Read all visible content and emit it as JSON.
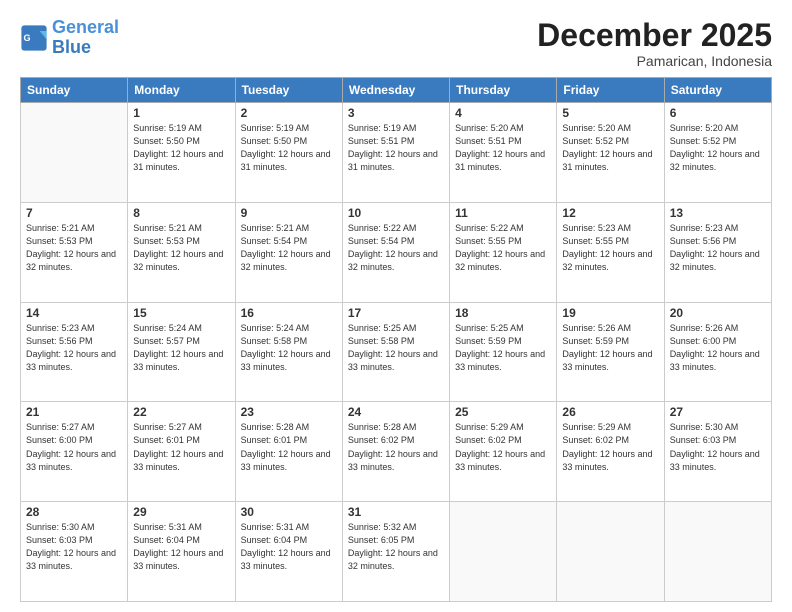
{
  "logo": {
    "line1": "General",
    "line2": "Blue"
  },
  "title": "December 2025",
  "location": "Pamarican, Indonesia",
  "weekdays": [
    "Sunday",
    "Monday",
    "Tuesday",
    "Wednesday",
    "Thursday",
    "Friday",
    "Saturday"
  ],
  "weeks": [
    [
      {
        "day": "",
        "sunrise": "",
        "sunset": "",
        "daylight": ""
      },
      {
        "day": "1",
        "sunrise": "Sunrise: 5:19 AM",
        "sunset": "Sunset: 5:50 PM",
        "daylight": "Daylight: 12 hours and 31 minutes."
      },
      {
        "day": "2",
        "sunrise": "Sunrise: 5:19 AM",
        "sunset": "Sunset: 5:50 PM",
        "daylight": "Daylight: 12 hours and 31 minutes."
      },
      {
        "day": "3",
        "sunrise": "Sunrise: 5:19 AM",
        "sunset": "Sunset: 5:51 PM",
        "daylight": "Daylight: 12 hours and 31 minutes."
      },
      {
        "day": "4",
        "sunrise": "Sunrise: 5:20 AM",
        "sunset": "Sunset: 5:51 PM",
        "daylight": "Daylight: 12 hours and 31 minutes."
      },
      {
        "day": "5",
        "sunrise": "Sunrise: 5:20 AM",
        "sunset": "Sunset: 5:52 PM",
        "daylight": "Daylight: 12 hours and 31 minutes."
      },
      {
        "day": "6",
        "sunrise": "Sunrise: 5:20 AM",
        "sunset": "Sunset: 5:52 PM",
        "daylight": "Daylight: 12 hours and 32 minutes."
      }
    ],
    [
      {
        "day": "7",
        "sunrise": "Sunrise: 5:21 AM",
        "sunset": "Sunset: 5:53 PM",
        "daylight": "Daylight: 12 hours and 32 minutes."
      },
      {
        "day": "8",
        "sunrise": "Sunrise: 5:21 AM",
        "sunset": "Sunset: 5:53 PM",
        "daylight": "Daylight: 12 hours and 32 minutes."
      },
      {
        "day": "9",
        "sunrise": "Sunrise: 5:21 AM",
        "sunset": "Sunset: 5:54 PM",
        "daylight": "Daylight: 12 hours and 32 minutes."
      },
      {
        "day": "10",
        "sunrise": "Sunrise: 5:22 AM",
        "sunset": "Sunset: 5:54 PM",
        "daylight": "Daylight: 12 hours and 32 minutes."
      },
      {
        "day": "11",
        "sunrise": "Sunrise: 5:22 AM",
        "sunset": "Sunset: 5:55 PM",
        "daylight": "Daylight: 12 hours and 32 minutes."
      },
      {
        "day": "12",
        "sunrise": "Sunrise: 5:23 AM",
        "sunset": "Sunset: 5:55 PM",
        "daylight": "Daylight: 12 hours and 32 minutes."
      },
      {
        "day": "13",
        "sunrise": "Sunrise: 5:23 AM",
        "sunset": "Sunset: 5:56 PM",
        "daylight": "Daylight: 12 hours and 32 minutes."
      }
    ],
    [
      {
        "day": "14",
        "sunrise": "Sunrise: 5:23 AM",
        "sunset": "Sunset: 5:56 PM",
        "daylight": "Daylight: 12 hours and 33 minutes."
      },
      {
        "day": "15",
        "sunrise": "Sunrise: 5:24 AM",
        "sunset": "Sunset: 5:57 PM",
        "daylight": "Daylight: 12 hours and 33 minutes."
      },
      {
        "day": "16",
        "sunrise": "Sunrise: 5:24 AM",
        "sunset": "Sunset: 5:58 PM",
        "daylight": "Daylight: 12 hours and 33 minutes."
      },
      {
        "day": "17",
        "sunrise": "Sunrise: 5:25 AM",
        "sunset": "Sunset: 5:58 PM",
        "daylight": "Daylight: 12 hours and 33 minutes."
      },
      {
        "day": "18",
        "sunrise": "Sunrise: 5:25 AM",
        "sunset": "Sunset: 5:59 PM",
        "daylight": "Daylight: 12 hours and 33 minutes."
      },
      {
        "day": "19",
        "sunrise": "Sunrise: 5:26 AM",
        "sunset": "Sunset: 5:59 PM",
        "daylight": "Daylight: 12 hours and 33 minutes."
      },
      {
        "day": "20",
        "sunrise": "Sunrise: 5:26 AM",
        "sunset": "Sunset: 6:00 PM",
        "daylight": "Daylight: 12 hours and 33 minutes."
      }
    ],
    [
      {
        "day": "21",
        "sunrise": "Sunrise: 5:27 AM",
        "sunset": "Sunset: 6:00 PM",
        "daylight": "Daylight: 12 hours and 33 minutes."
      },
      {
        "day": "22",
        "sunrise": "Sunrise: 5:27 AM",
        "sunset": "Sunset: 6:01 PM",
        "daylight": "Daylight: 12 hours and 33 minutes."
      },
      {
        "day": "23",
        "sunrise": "Sunrise: 5:28 AM",
        "sunset": "Sunset: 6:01 PM",
        "daylight": "Daylight: 12 hours and 33 minutes."
      },
      {
        "day": "24",
        "sunrise": "Sunrise: 5:28 AM",
        "sunset": "Sunset: 6:02 PM",
        "daylight": "Daylight: 12 hours and 33 minutes."
      },
      {
        "day": "25",
        "sunrise": "Sunrise: 5:29 AM",
        "sunset": "Sunset: 6:02 PM",
        "daylight": "Daylight: 12 hours and 33 minutes."
      },
      {
        "day": "26",
        "sunrise": "Sunrise: 5:29 AM",
        "sunset": "Sunset: 6:02 PM",
        "daylight": "Daylight: 12 hours and 33 minutes."
      },
      {
        "day": "27",
        "sunrise": "Sunrise: 5:30 AM",
        "sunset": "Sunset: 6:03 PM",
        "daylight": "Daylight: 12 hours and 33 minutes."
      }
    ],
    [
      {
        "day": "28",
        "sunrise": "Sunrise: 5:30 AM",
        "sunset": "Sunset: 6:03 PM",
        "daylight": "Daylight: 12 hours and 33 minutes."
      },
      {
        "day": "29",
        "sunrise": "Sunrise: 5:31 AM",
        "sunset": "Sunset: 6:04 PM",
        "daylight": "Daylight: 12 hours and 33 minutes."
      },
      {
        "day": "30",
        "sunrise": "Sunrise: 5:31 AM",
        "sunset": "Sunset: 6:04 PM",
        "daylight": "Daylight: 12 hours and 33 minutes."
      },
      {
        "day": "31",
        "sunrise": "Sunrise: 5:32 AM",
        "sunset": "Sunset: 6:05 PM",
        "daylight": "Daylight: 12 hours and 32 minutes."
      },
      {
        "day": "",
        "sunrise": "",
        "sunset": "",
        "daylight": ""
      },
      {
        "day": "",
        "sunrise": "",
        "sunset": "",
        "daylight": ""
      },
      {
        "day": "",
        "sunrise": "",
        "sunset": "",
        "daylight": ""
      }
    ]
  ]
}
